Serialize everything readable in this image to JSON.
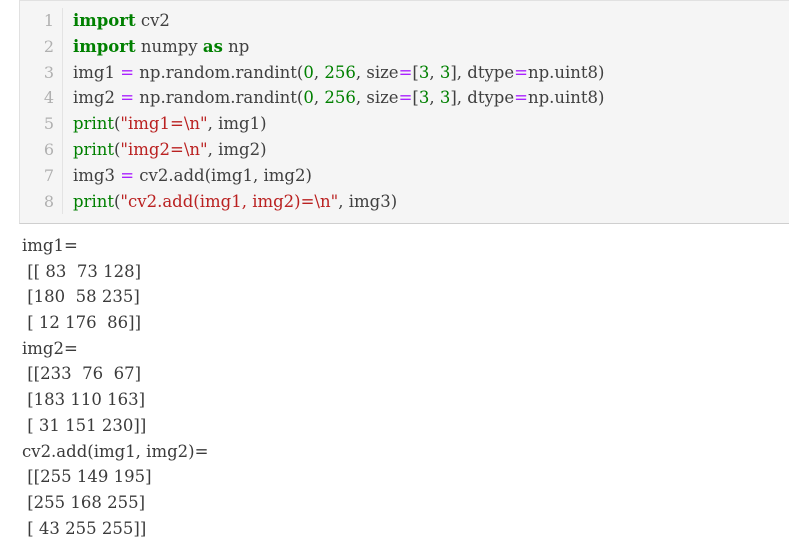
{
  "cell": {
    "prompt_marker": "[ ]:",
    "line_numbers": [
      "1",
      "2",
      "3",
      "4",
      "5",
      "6",
      "7",
      "8"
    ],
    "code_lines": [
      [
        {
          "t": "import",
          "c": "kw"
        },
        {
          "t": " cv2",
          "c": "txt"
        }
      ],
      [
        {
          "t": "import",
          "c": "kw"
        },
        {
          "t": " numpy ",
          "c": "txt"
        },
        {
          "t": "as",
          "c": "kw"
        },
        {
          "t": " np",
          "c": "txt"
        }
      ],
      [
        {
          "t": "img1 ",
          "c": "txt"
        },
        {
          "t": "=",
          "c": "op"
        },
        {
          "t": " np.random.randint(",
          "c": "txt"
        },
        {
          "t": "0",
          "c": "num"
        },
        {
          "t": ", ",
          "c": "txt"
        },
        {
          "t": "256",
          "c": "num"
        },
        {
          "t": ", size",
          "c": "txt"
        },
        {
          "t": "=",
          "c": "op"
        },
        {
          "t": "[",
          "c": "txt"
        },
        {
          "t": "3",
          "c": "num"
        },
        {
          "t": ", ",
          "c": "txt"
        },
        {
          "t": "3",
          "c": "num"
        },
        {
          "t": "], dtype",
          "c": "txt"
        },
        {
          "t": "=",
          "c": "op"
        },
        {
          "t": "np.uint8)",
          "c": "txt"
        }
      ],
      [
        {
          "t": "img2 ",
          "c": "txt"
        },
        {
          "t": "=",
          "c": "op"
        },
        {
          "t": " np.random.randint(",
          "c": "txt"
        },
        {
          "t": "0",
          "c": "num"
        },
        {
          "t": ", ",
          "c": "txt"
        },
        {
          "t": "256",
          "c": "num"
        },
        {
          "t": ", size",
          "c": "txt"
        },
        {
          "t": "=",
          "c": "op"
        },
        {
          "t": "[",
          "c": "txt"
        },
        {
          "t": "3",
          "c": "num"
        },
        {
          "t": ", ",
          "c": "txt"
        },
        {
          "t": "3",
          "c": "num"
        },
        {
          "t": "], dtype",
          "c": "txt"
        },
        {
          "t": "=",
          "c": "op"
        },
        {
          "t": "np.uint8)",
          "c": "txt"
        }
      ],
      [
        {
          "t": "print",
          "c": "bi"
        },
        {
          "t": "(",
          "c": "txt"
        },
        {
          "t": "\"img1=\\n\"",
          "c": "str"
        },
        {
          "t": ", img1)",
          "c": "txt"
        }
      ],
      [
        {
          "t": "print",
          "c": "bi"
        },
        {
          "t": "(",
          "c": "txt"
        },
        {
          "t": "\"img2=\\n\"",
          "c": "str"
        },
        {
          "t": ", img2)",
          "c": "txt"
        }
      ],
      [
        {
          "t": "img3 ",
          "c": "txt"
        },
        {
          "t": "=",
          "c": "op"
        },
        {
          "t": " cv2.add(img1, img2)",
          "c": "txt"
        }
      ],
      [
        {
          "t": "print",
          "c": "bi"
        },
        {
          "t": "(",
          "c": "txt"
        },
        {
          "t": "\"cv2.add(img1, img2)=\\n\"",
          "c": "str"
        },
        {
          "t": ", img3)",
          "c": "txt"
        }
      ]
    ]
  },
  "output": {
    "lines": [
      "img1=",
      " [[ 83  73 128]",
      " [180  58 235]",
      " [ 12 176  86]]",
      "img2=",
      " [[233  76  67]",
      " [183 110 163]",
      " [ 31 151 230]]",
      "cv2.add(img1, img2)=",
      " [[255 149 195]",
      " [255 168 255]",
      " [ 43 255 255]]"
    ],
    "arrays": {
      "img1": [
        [
          83,
          73,
          128
        ],
        [
          180,
          58,
          235
        ],
        [
          12,
          176,
          86
        ]
      ],
      "img2": [
        [
          233,
          76,
          67
        ],
        [
          183,
          110,
          163
        ],
        [
          31,
          151,
          230
        ]
      ],
      "cv2_add_img1_img2": [
        [
          255,
          149,
          195
        ],
        [
          255,
          168,
          255
        ],
        [
          43,
          255,
          255
        ]
      ]
    }
  },
  "colors": {
    "keyword": "#008000",
    "builtin": "#008000",
    "number": "#008000",
    "operator": "#aa22ff",
    "string": "#ba2121",
    "code_text": "#404040",
    "lineno": "#b0b0b0",
    "cell_background": "#f5f5f5",
    "output_text": "#3b3b3b",
    "prompt": "#303f9f"
  }
}
